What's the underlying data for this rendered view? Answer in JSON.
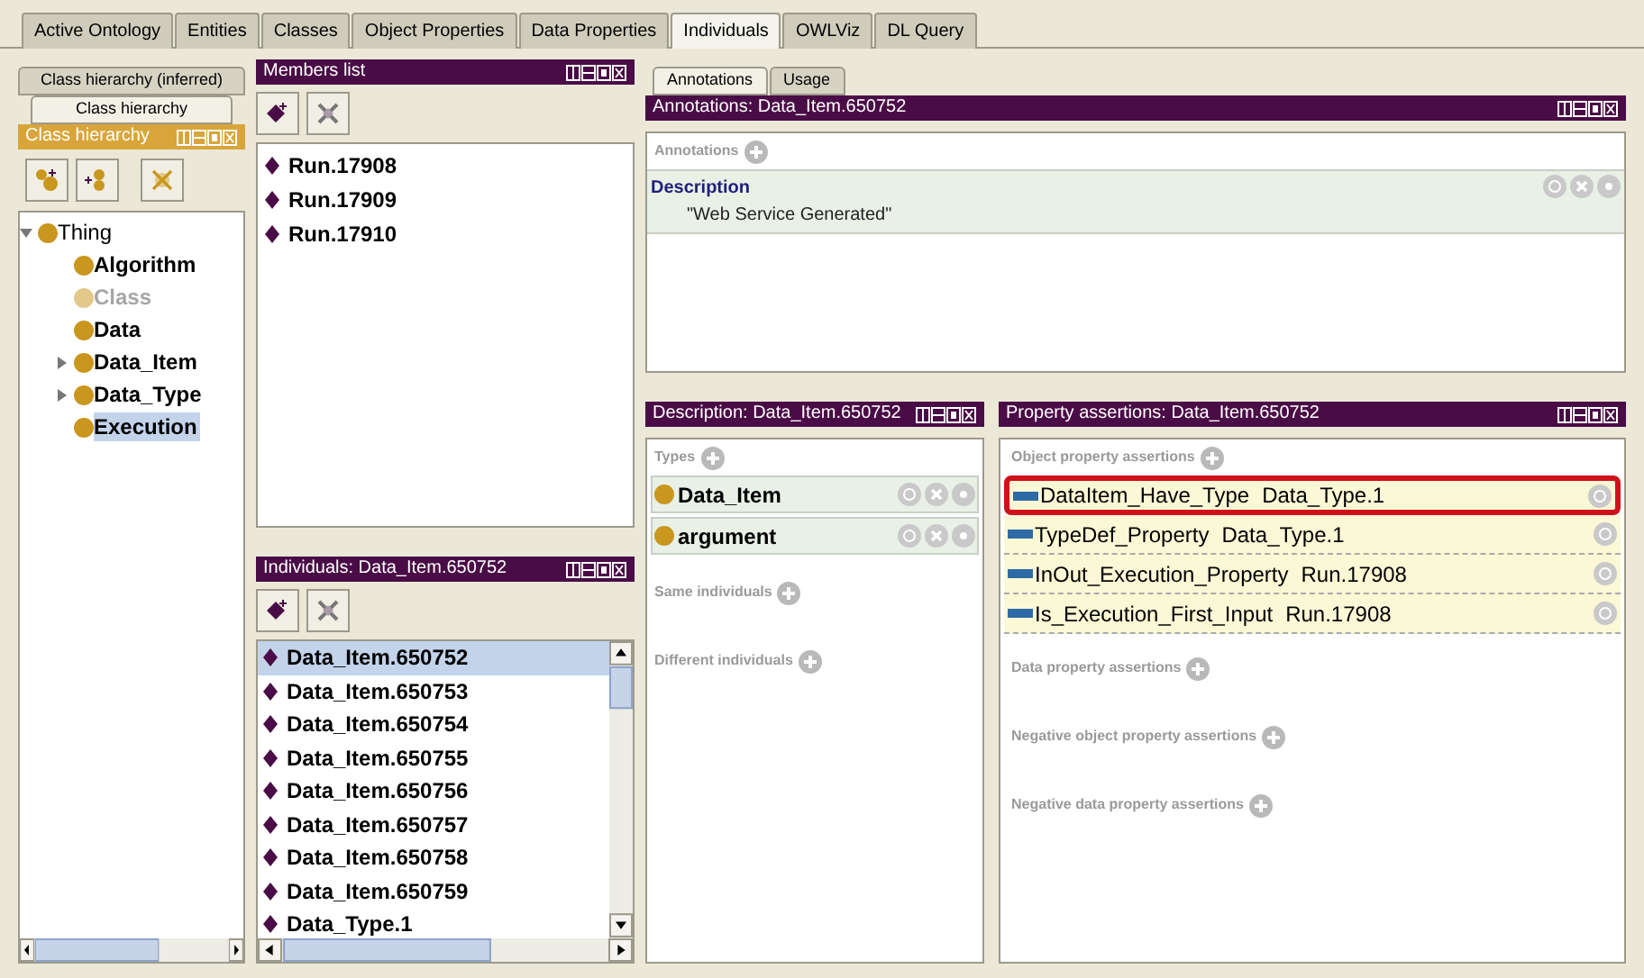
{
  "tabs": [
    {
      "label": "Active Ontology",
      "selected": false
    },
    {
      "label": "Entities",
      "selected": false
    },
    {
      "label": "Classes",
      "selected": false
    },
    {
      "label": "Object Properties",
      "selected": false
    },
    {
      "label": "Data Properties",
      "selected": false
    },
    {
      "label": "Individuals",
      "selected": true
    },
    {
      "label": "OWLViz",
      "selected": false
    },
    {
      "label": "DL Query",
      "selected": false
    }
  ],
  "class_panel": {
    "tabs": [
      {
        "label": "Class hierarchy (inferred)",
        "selected": false
      },
      {
        "label": "Class hierarchy",
        "selected": true
      }
    ],
    "title": "Class hierarchy",
    "tree": [
      {
        "label": "Thing",
        "expanded": true,
        "selected": false,
        "greyed": false,
        "children": [
          {
            "label": "Algorithm",
            "selected": false,
            "greyed": false
          },
          {
            "label": "Class",
            "selected": false,
            "greyed": true
          },
          {
            "label": "Data",
            "selected": false,
            "greyed": false
          },
          {
            "label": "Data_Item",
            "expanded": false,
            "selected": false,
            "greyed": false
          },
          {
            "label": "Data_Type",
            "expanded": false,
            "selected": false,
            "greyed": false
          },
          {
            "label": "Execution",
            "selected": true,
            "greyed": false
          }
        ]
      }
    ]
  },
  "members_list": {
    "title": "Members list",
    "items": [
      "Run.17908",
      "Run.17909",
      "Run.17910"
    ]
  },
  "individuals": {
    "title": "Individuals: Data_Item.650752",
    "items": [
      {
        "label": "Data_Item.650752",
        "selected": true
      },
      {
        "label": "Data_Item.650753",
        "selected": false
      },
      {
        "label": "Data_Item.650754",
        "selected": false
      },
      {
        "label": "Data_Item.650755",
        "selected": false
      },
      {
        "label": "Data_Item.650756",
        "selected": false
      },
      {
        "label": "Data_Item.650757",
        "selected": false
      },
      {
        "label": "Data_Item.650758",
        "selected": false
      },
      {
        "label": "Data_Item.650759",
        "selected": false
      },
      {
        "label": "Data_Type.1",
        "selected": false
      }
    ]
  },
  "annotations_panel": {
    "tabs": [
      {
        "label": "Annotations",
        "selected": true
      },
      {
        "label": "Usage",
        "selected": false
      }
    ],
    "title": "Annotations: Data_Item.650752",
    "section_label": "Annotations",
    "annotations": [
      {
        "property": "Description",
        "value": "\"Web Service Generated\""
      }
    ]
  },
  "description_panel": {
    "title": "Description: Data_Item.650752",
    "types_label": "Types",
    "types": [
      "Data_Item",
      "argument"
    ],
    "sections": [
      "Same individuals",
      "Different individuals"
    ]
  },
  "property_panel": {
    "title": "Property assertions: Data_Item.650752",
    "object_label": "Object property assertions",
    "assertions": [
      {
        "property": "DataItem_Have_Type",
        "value": "Data_Type.1",
        "highlighted": true
      },
      {
        "property": "TypeDef_Property",
        "value": "Data_Type.1",
        "highlighted": false
      },
      {
        "property": "InOut_Execution_Property",
        "value": "Run.17908",
        "highlighted": false
      },
      {
        "property": "Is_Execution_First_Input",
        "value": "Run.17908",
        "highlighted": false
      }
    ],
    "sections": [
      "Data property assertions",
      "Negative object property assertions",
      "Negative data property assertions"
    ]
  }
}
